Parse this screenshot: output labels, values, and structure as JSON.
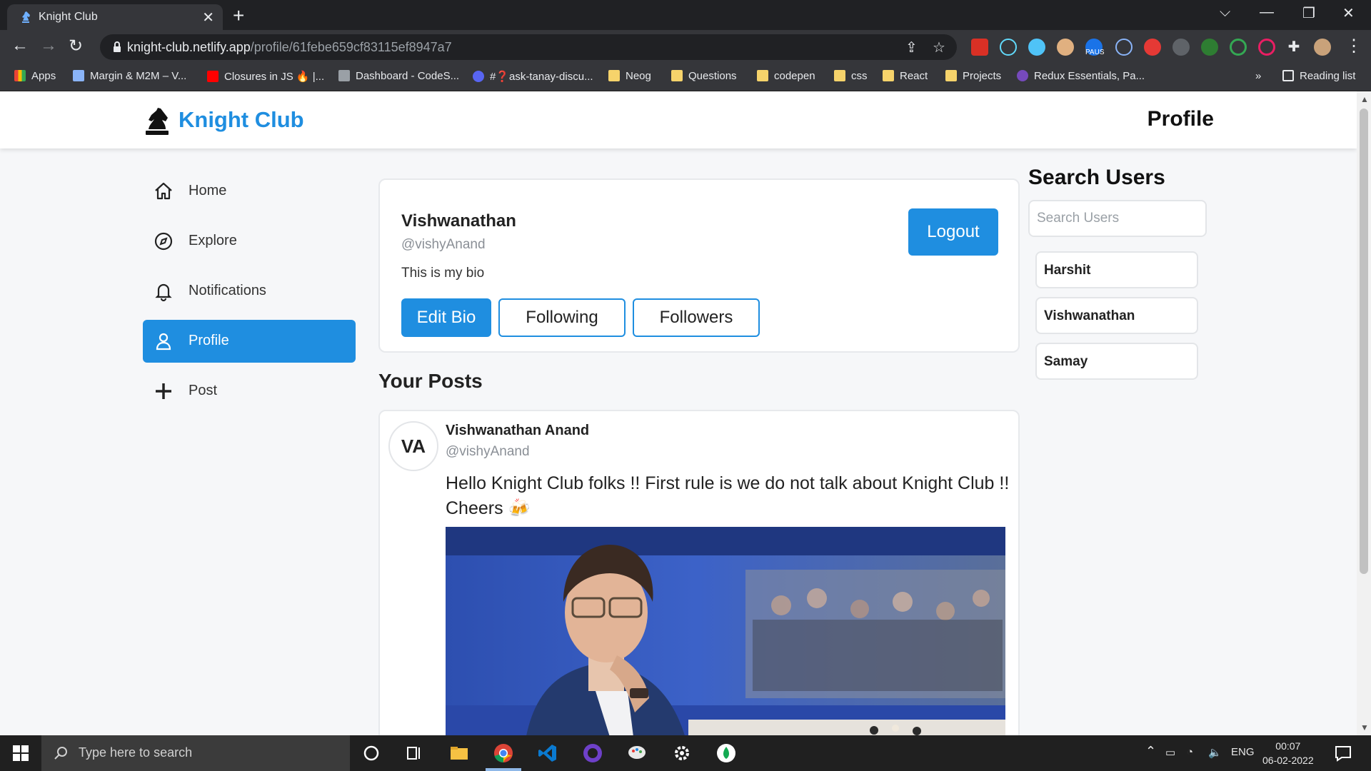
{
  "browser": {
    "tab_title": "Knight Club",
    "url_host": "knight-club.netlify.app",
    "url_path": "/profile/61febe659cf83115ef8947a7",
    "bookmarks": [
      {
        "label": "Apps",
        "icon": "apps-grid-icon"
      },
      {
        "label": "Margin & M2M – V...",
        "icon": "shield-icon"
      },
      {
        "label": "Closures in JS 🔥 |...",
        "icon": "youtube-icon"
      },
      {
        "label": "Dashboard - CodeS...",
        "icon": "code-icon"
      },
      {
        "label": "#❓ask-tanay-discu...",
        "icon": "discord-icon"
      },
      {
        "label": "Neog",
        "icon": "folder-icon"
      },
      {
        "label": "Questions",
        "icon": "folder-icon"
      },
      {
        "label": "codepen",
        "icon": "folder-icon"
      },
      {
        "label": "css",
        "icon": "folder-icon"
      },
      {
        "label": "React",
        "icon": "folder-icon"
      },
      {
        "label": "Projects",
        "icon": "folder-icon"
      },
      {
        "label": "Redux Essentials, Pa...",
        "icon": "redux-icon"
      }
    ],
    "overflow": "»",
    "reading_list": "Reading list",
    "ext_badge": "PAUS"
  },
  "app": {
    "brand": "Knight Club",
    "page_title": "Profile",
    "accent": "#1f8ee0"
  },
  "nav": [
    {
      "label": "Home",
      "icon": "home-icon"
    },
    {
      "label": "Explore",
      "icon": "compass-icon"
    },
    {
      "label": "Notifications",
      "icon": "bell-icon"
    },
    {
      "label": "Profile",
      "icon": "user-icon",
      "active": true
    },
    {
      "label": "Post",
      "icon": "plus-icon"
    }
  ],
  "profile": {
    "name": "Vishwanathan",
    "handle": "@vishyAnand",
    "bio": "This is my bio",
    "logout_label": "Logout",
    "edit_bio_label": "Edit Bio",
    "following_label": "Following",
    "followers_label": "Followers"
  },
  "posts_heading": "Your Posts",
  "post": {
    "avatar_initials": "VA",
    "author": "Vishwanathan Anand",
    "handle": "@vishyAnand",
    "text": "Hello Knight Club folks !! First rule is we do not talk about Knight Club !! Cheers 🍻"
  },
  "search": {
    "heading": "Search Users",
    "placeholder": "Search Users",
    "users": [
      "Harshit",
      "Vishwanathan",
      "Samay"
    ]
  },
  "taskbar": {
    "search_placeholder": "Type here to search",
    "lang": "ENG",
    "time": "00:07",
    "date": "06-02-2022"
  }
}
